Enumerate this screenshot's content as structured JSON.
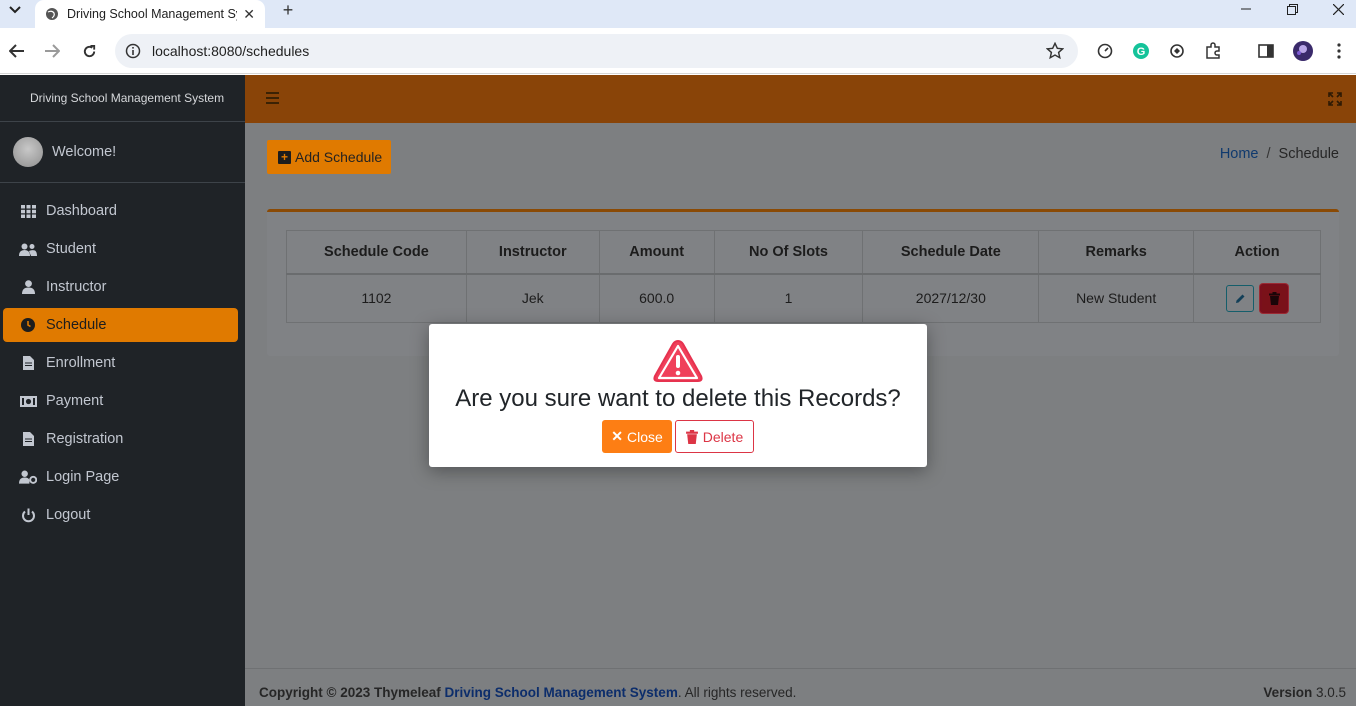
{
  "browser": {
    "tab_title": "Driving School Management Sy",
    "url": "localhost:8080/schedules",
    "icons": [
      "tab-search-icon",
      "globe-icon",
      "close-icon",
      "plus-icon",
      "minimize-icon",
      "restore-icon",
      "window-close-icon",
      "back-icon",
      "forward-icon",
      "reload-icon",
      "site-info-icon",
      "star-icon",
      "speed-icon",
      "grammarly-icon",
      "sync-icon",
      "extensions-icon",
      "side-panel-icon",
      "profile-avatar",
      "more-icon"
    ]
  },
  "sidebar": {
    "brand": "Driving School Management System",
    "welcome": "Welcome!",
    "active_color": "#e07a00",
    "items": [
      {
        "label": "Dashboard",
        "icon": "grid-icon"
      },
      {
        "label": "Student",
        "icon": "users-icon"
      },
      {
        "label": "Instructor",
        "icon": "user-icon"
      },
      {
        "label": "Schedule",
        "icon": "clock-icon",
        "active": true
      },
      {
        "label": "Enrollment",
        "icon": "file-icon"
      },
      {
        "label": "Payment",
        "icon": "money-icon"
      },
      {
        "label": "Registration",
        "icon": "file-icon"
      },
      {
        "label": "Login Page",
        "icon": "user-cog-icon"
      },
      {
        "label": "Logout",
        "icon": "power-icon"
      }
    ]
  },
  "header": {
    "hamburger_icon": "bars-icon",
    "expand_icon": "expand-icon",
    "color": "#894408"
  },
  "page": {
    "add_button": "Add Schedule",
    "breadcrumb": {
      "home": "Home",
      "separator": "/",
      "current": "Schedule"
    }
  },
  "table": {
    "headers": [
      "Schedule Code",
      "Instructor",
      "Amount",
      "No Of Slots",
      "Schedule Date",
      "Remarks",
      "Action"
    ],
    "rows": [
      {
        "code": "1102",
        "instructor": "Jek",
        "amount": "600.0",
        "slots": "1",
        "date": "2027/12/30",
        "remarks": "New Student"
      }
    ]
  },
  "modal": {
    "icon": "warning-triangle-icon",
    "title": "Are you sure want to delete this Records?",
    "close_label": "Close",
    "delete_label": "Delete",
    "close_color": "#fd7e14",
    "delete_color": "#dc3545"
  },
  "footer": {
    "copyright_prefix": "Copyright © 2023 Thymeleaf",
    "link": "Driving School Management System",
    "suffix": ". All rights reserved.",
    "version_label": "Version",
    "version": "3.0.5"
  }
}
